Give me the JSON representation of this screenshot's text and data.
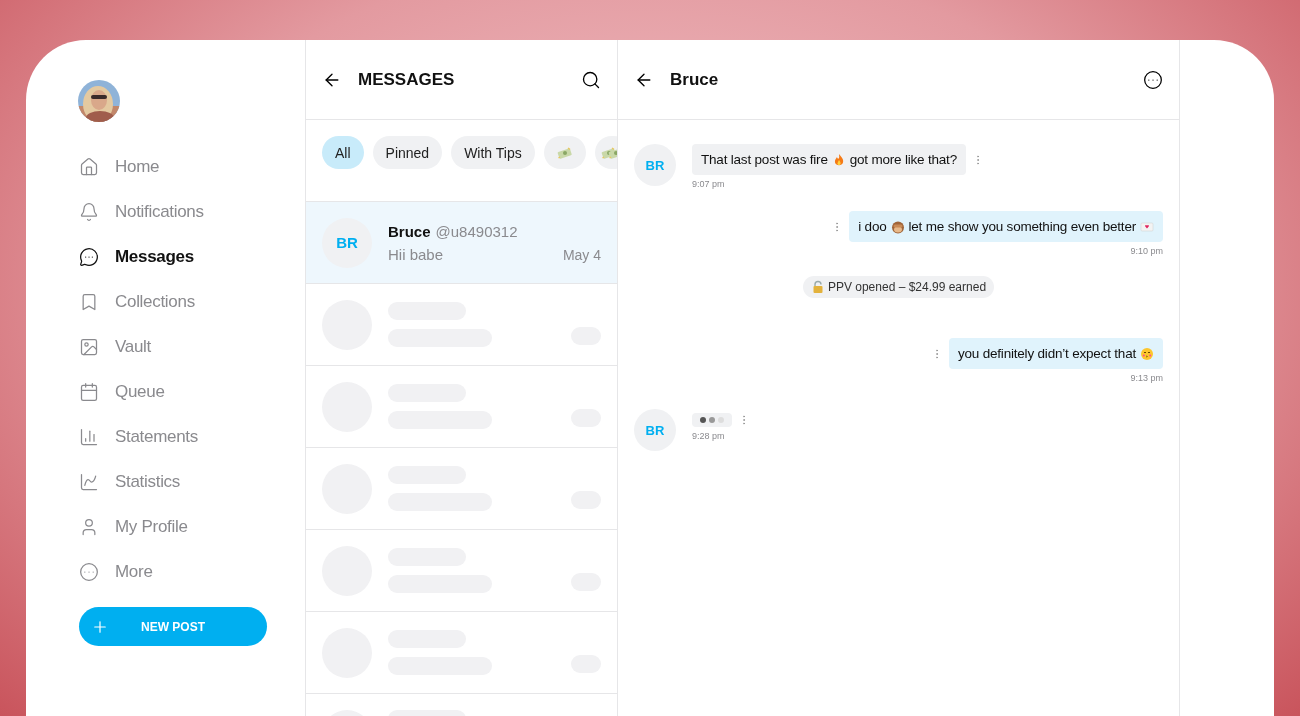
{
  "sidebar": {
    "items": [
      {
        "label": "Home",
        "selected": false
      },
      {
        "label": "Notifications",
        "selected": false
      },
      {
        "label": "Messages",
        "selected": true
      },
      {
        "label": "Collections",
        "selected": false
      },
      {
        "label": "Vault",
        "selected": false
      },
      {
        "label": "Queue",
        "selected": false
      },
      {
        "label": "Statements",
        "selected": false
      },
      {
        "label": "Statistics",
        "selected": false
      },
      {
        "label": "My Profile",
        "selected": false
      },
      {
        "label": "More",
        "selected": false
      }
    ],
    "new_post_button": {
      "label": "NEW POST"
    }
  },
  "messages_panel": {
    "title": "MESSAGES",
    "filters": [
      {
        "kind": "text",
        "label": "All",
        "selected": true
      },
      {
        "kind": "text",
        "label": "Pinned",
        "selected": false
      },
      {
        "kind": "text",
        "label": "With Tips",
        "selected": false
      },
      {
        "kind": "money",
        "selected": false
      },
      {
        "kind": "money_stack",
        "selected": false
      }
    ],
    "conversations": [
      {
        "initials": "BR",
        "name": "Bruce",
        "handle": "@u8490312",
        "preview": "Hii babe",
        "date": "May 4",
        "selected": true
      }
    ],
    "loading_rows": [
      {
        "kind": "skeleton"
      },
      {
        "kind": "skeleton"
      },
      {
        "kind": "skeleton"
      },
      {
        "kind": "skeleton"
      },
      {
        "kind": "skeleton"
      },
      {
        "kind": "skeleton_cut"
      }
    ]
  },
  "chat": {
    "title": "Bruce",
    "messages": [
      {
        "kind": "incoming",
        "initials": "BR",
        "parts": [
          {
            "kind": "text",
            "text": "That last post was fire"
          },
          {
            "kind": "fire"
          },
          {
            "kind": "text",
            "text": "got more like that?"
          }
        ],
        "time": "9:07 pm"
      },
      {
        "kind": "outgoing",
        "parts": [
          {
            "kind": "text",
            "text": "i doo"
          },
          {
            "kind": "monkey"
          },
          {
            "kind": "text",
            "text": "let me show you something even better"
          },
          {
            "kind": "letter"
          }
        ],
        "time": "9:10 pm"
      },
      {
        "kind": "notice",
        "parts": [
          {
            "kind": "lock"
          },
          {
            "kind": "text",
            "text": "PPV opened – $24.99 earned"
          }
        ]
      },
      {
        "kind": "outgoing",
        "parts": [
          {
            "kind": "text",
            "text": "you definitely didn’t expect that"
          },
          {
            "kind": "kiss"
          }
        ],
        "time": "9:13 pm"
      },
      {
        "kind": "typing",
        "initials": "BR",
        "time": "9:28 pm"
      }
    ]
  }
}
